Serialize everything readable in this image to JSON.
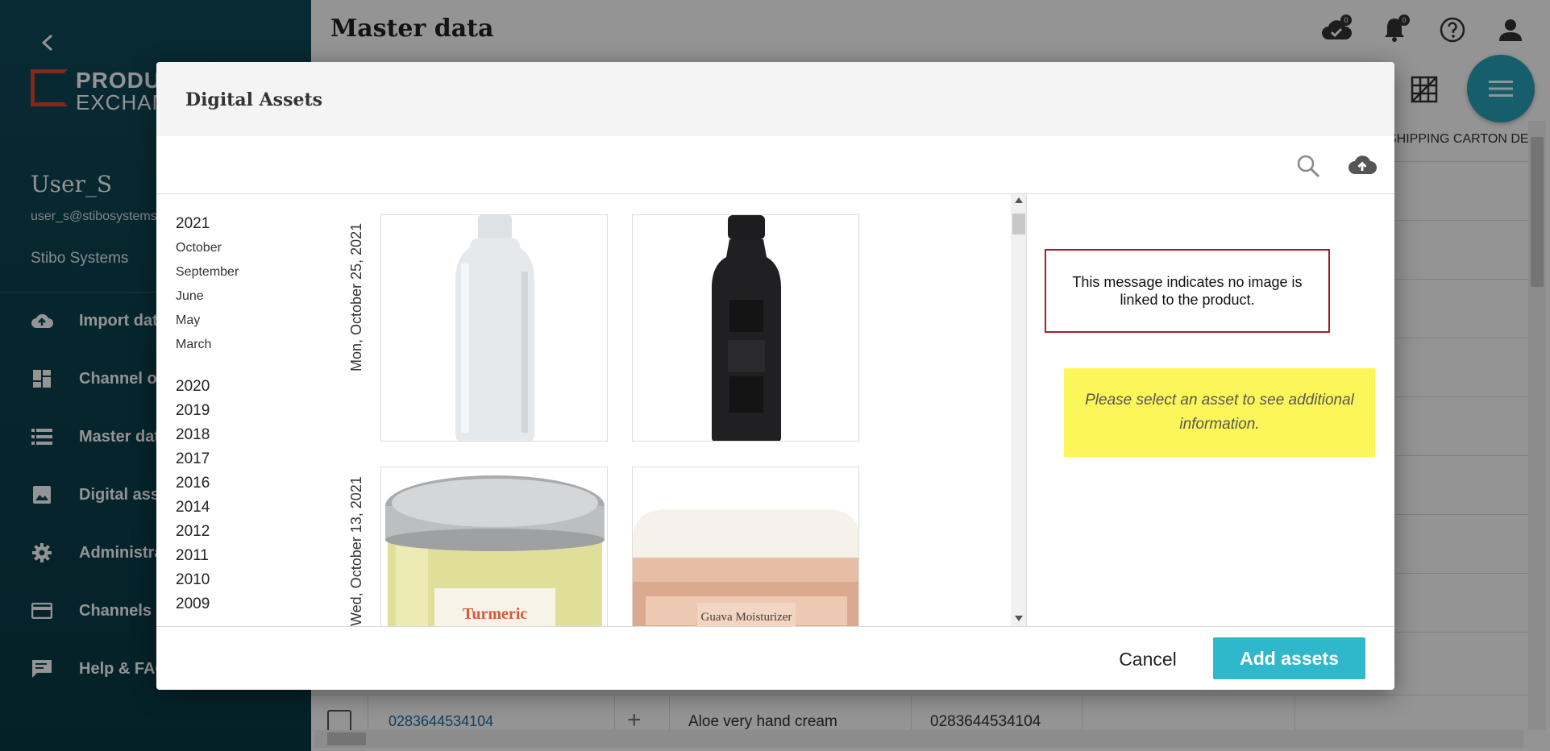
{
  "sidebar": {
    "logo": {
      "line1": "PRODUCT",
      "line2": "EXCHANGE"
    },
    "user_name": "User_S",
    "user_email": "user_s@stibosystems.com",
    "organization": "Stibo Systems",
    "items": [
      {
        "label": "Import data",
        "icon": "cloud-upload-icon"
      },
      {
        "label": "Channel overview",
        "icon": "dashboard-icon"
      },
      {
        "label": "Master data",
        "icon": "list-icon"
      },
      {
        "label": "Digital assets",
        "icon": "image-icon"
      },
      {
        "label": "Administration",
        "icon": "gear-icon"
      },
      {
        "label": "Channels",
        "icon": "card-icon"
      },
      {
        "label": "Help & FAQ",
        "icon": "chat-icon"
      }
    ]
  },
  "main": {
    "title": "Master data",
    "notifications": {
      "cloud_count": "0",
      "bell_count": "0"
    },
    "column_header": "SHIPPING CARTON DEPTH",
    "row": {
      "link": "0283644534104",
      "name": "Aloe very hand cream",
      "code": "0283644534104"
    }
  },
  "modal": {
    "title": "Digital Assets",
    "years": [
      {
        "year": "2021",
        "months": [
          "October",
          "September",
          "June",
          "May",
          "March"
        ]
      },
      {
        "year": "2020",
        "months": []
      },
      {
        "year": "2019",
        "months": []
      },
      {
        "year": "2018",
        "months": []
      },
      {
        "year": "2017",
        "months": []
      },
      {
        "year": "2016",
        "months": []
      },
      {
        "year": "2014",
        "months": []
      },
      {
        "year": "2012",
        "months": []
      },
      {
        "year": "2011",
        "months": []
      },
      {
        "year": "2010",
        "months": []
      },
      {
        "year": "2009",
        "months": []
      }
    ],
    "groups": [
      {
        "date": "Mon, October 25, 2021"
      },
      {
        "date": "Wed, October 13, 2021"
      }
    ],
    "asset_texts": {
      "turmeric": "Turmeric",
      "guava": "Guava Moisturizer"
    },
    "callout": "This message indicates no image is linked to the product.",
    "info": "Please select an asset to see additional information.",
    "cancel_label": "Cancel",
    "add_label": "Add assets"
  },
  "colors": {
    "accent": "#2fb8cc",
    "sidebar": "#0f4a58",
    "callout_border": "#a81d2a",
    "info_bg": "#fdf65a",
    "logo_red": "#e2472f"
  }
}
